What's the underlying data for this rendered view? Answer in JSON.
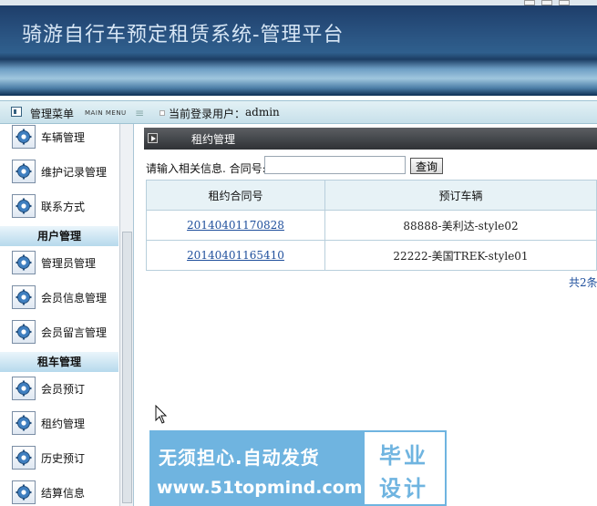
{
  "app": {
    "title": "骑游自行车预定租赁系统-管理平台"
  },
  "topbar": {
    "menu_label": "管理菜单",
    "menu_label_en": "MAIN MENU",
    "menu_icon_glyph": "≡",
    "user_label": "当前登录用户：",
    "user_name": "admin"
  },
  "sidebar": {
    "items": [
      {
        "type": "item",
        "label": "车辆管理"
      },
      {
        "type": "item",
        "label": "维护记录管理"
      },
      {
        "type": "item",
        "label": "联系方式"
      },
      {
        "type": "group",
        "label": "用户管理"
      },
      {
        "type": "item",
        "label": "管理员管理"
      },
      {
        "type": "item",
        "label": "会员信息管理"
      },
      {
        "type": "item",
        "label": "会员留言管理"
      },
      {
        "type": "group",
        "label": "租车管理"
      },
      {
        "type": "item",
        "label": "会员预订"
      },
      {
        "type": "item",
        "label": "租约管理"
      },
      {
        "type": "item",
        "label": "历史预订"
      },
      {
        "type": "item",
        "label": "结算信息"
      }
    ]
  },
  "content": {
    "title": "租约管理",
    "search": {
      "label": "请输入相关信息. 合同号:",
      "value": "",
      "button": "查询"
    },
    "table": {
      "headers": [
        "租约合同号",
        "预订车辆"
      ],
      "rows": [
        {
          "contract": "20140401170828",
          "bike": "88888-美利达-style02"
        },
        {
          "contract": "20140401165410",
          "bike": "22222-美国TREK-style01"
        }
      ]
    },
    "total": "共2条"
  },
  "ad": {
    "line1": "无须担心.自动发货",
    "line2": "www.51topmind.com",
    "badge_line1": "毕业",
    "badge_line2": "设计"
  },
  "colors": {
    "banner": "#2b5684",
    "sidebar_group": "#b6d9ec",
    "content_header": "#3a3d41",
    "link": "#1f4f9c",
    "ad_bg": "#6fb4e0"
  },
  "icons": {
    "sidebar_item": "gear-icon",
    "content_header": "play-arrow-icon",
    "topbar": "window-icon",
    "cursor": "mouse-pointer-icon"
  }
}
